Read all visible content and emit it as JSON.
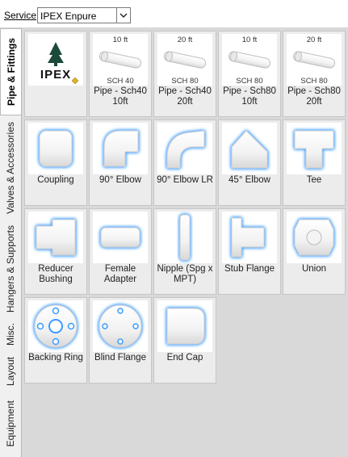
{
  "service": {
    "label": "Service",
    "value": "IPEX Enpure"
  },
  "tabs": [
    {
      "label": "Pipe & Fittings",
      "active": true
    },
    {
      "label": "Valves & Accessories",
      "active": false
    },
    {
      "label": "Hangers & Supports",
      "active": false
    },
    {
      "label": "Misc.",
      "active": false
    },
    {
      "label": "Layout",
      "active": false
    },
    {
      "label": "Equipment",
      "active": false
    }
  ],
  "tiles": [
    {
      "label": "",
      "brand": "IPEX",
      "icon": "ipex-logo"
    },
    {
      "label": "Pipe - Sch40 10ft",
      "top": "10 ft",
      "bottom": "SCH 40",
      "icon": "pipe-icon"
    },
    {
      "label": "Pipe - Sch40 20ft",
      "top": "20 ft",
      "bottom": "SCH 80",
      "icon": "pipe-icon"
    },
    {
      "label": "Pipe - Sch80 10ft",
      "top": "10 ft",
      "bottom": "SCH 80",
      "icon": "pipe-icon"
    },
    {
      "label": "Pipe - Sch80 20ft",
      "top": "20 ft",
      "bottom": "SCH 80",
      "icon": "pipe-icon"
    },
    {
      "label": "Coupling",
      "icon": "coupling-icon"
    },
    {
      "label": "90° Elbow",
      "icon": "elbow-90-icon"
    },
    {
      "label": "90° Elbow LR",
      "icon": "elbow-90-lr-icon"
    },
    {
      "label": "45° Elbow",
      "icon": "elbow-45-icon"
    },
    {
      "label": "Tee",
      "icon": "tee-icon"
    },
    {
      "label": "Reducer Bushing",
      "icon": "reducer-bushing-icon"
    },
    {
      "label": "Female Adapter",
      "icon": "female-adapter-icon"
    },
    {
      "label": "Nipple (Spg x MPT)",
      "icon": "nipple-icon"
    },
    {
      "label": "Stub Flange",
      "icon": "stub-flange-icon"
    },
    {
      "label": "Union",
      "icon": "union-icon"
    },
    {
      "label": "Backing Ring",
      "icon": "backing-ring-icon"
    },
    {
      "label": "Blind Flange",
      "icon": "blind-flange-icon"
    },
    {
      "label": "End Cap",
      "icon": "end-cap-icon"
    }
  ],
  "colors": {
    "glow": "#3a9bff",
    "panel": "#d9d9d9",
    "tile": "#ececec"
  }
}
